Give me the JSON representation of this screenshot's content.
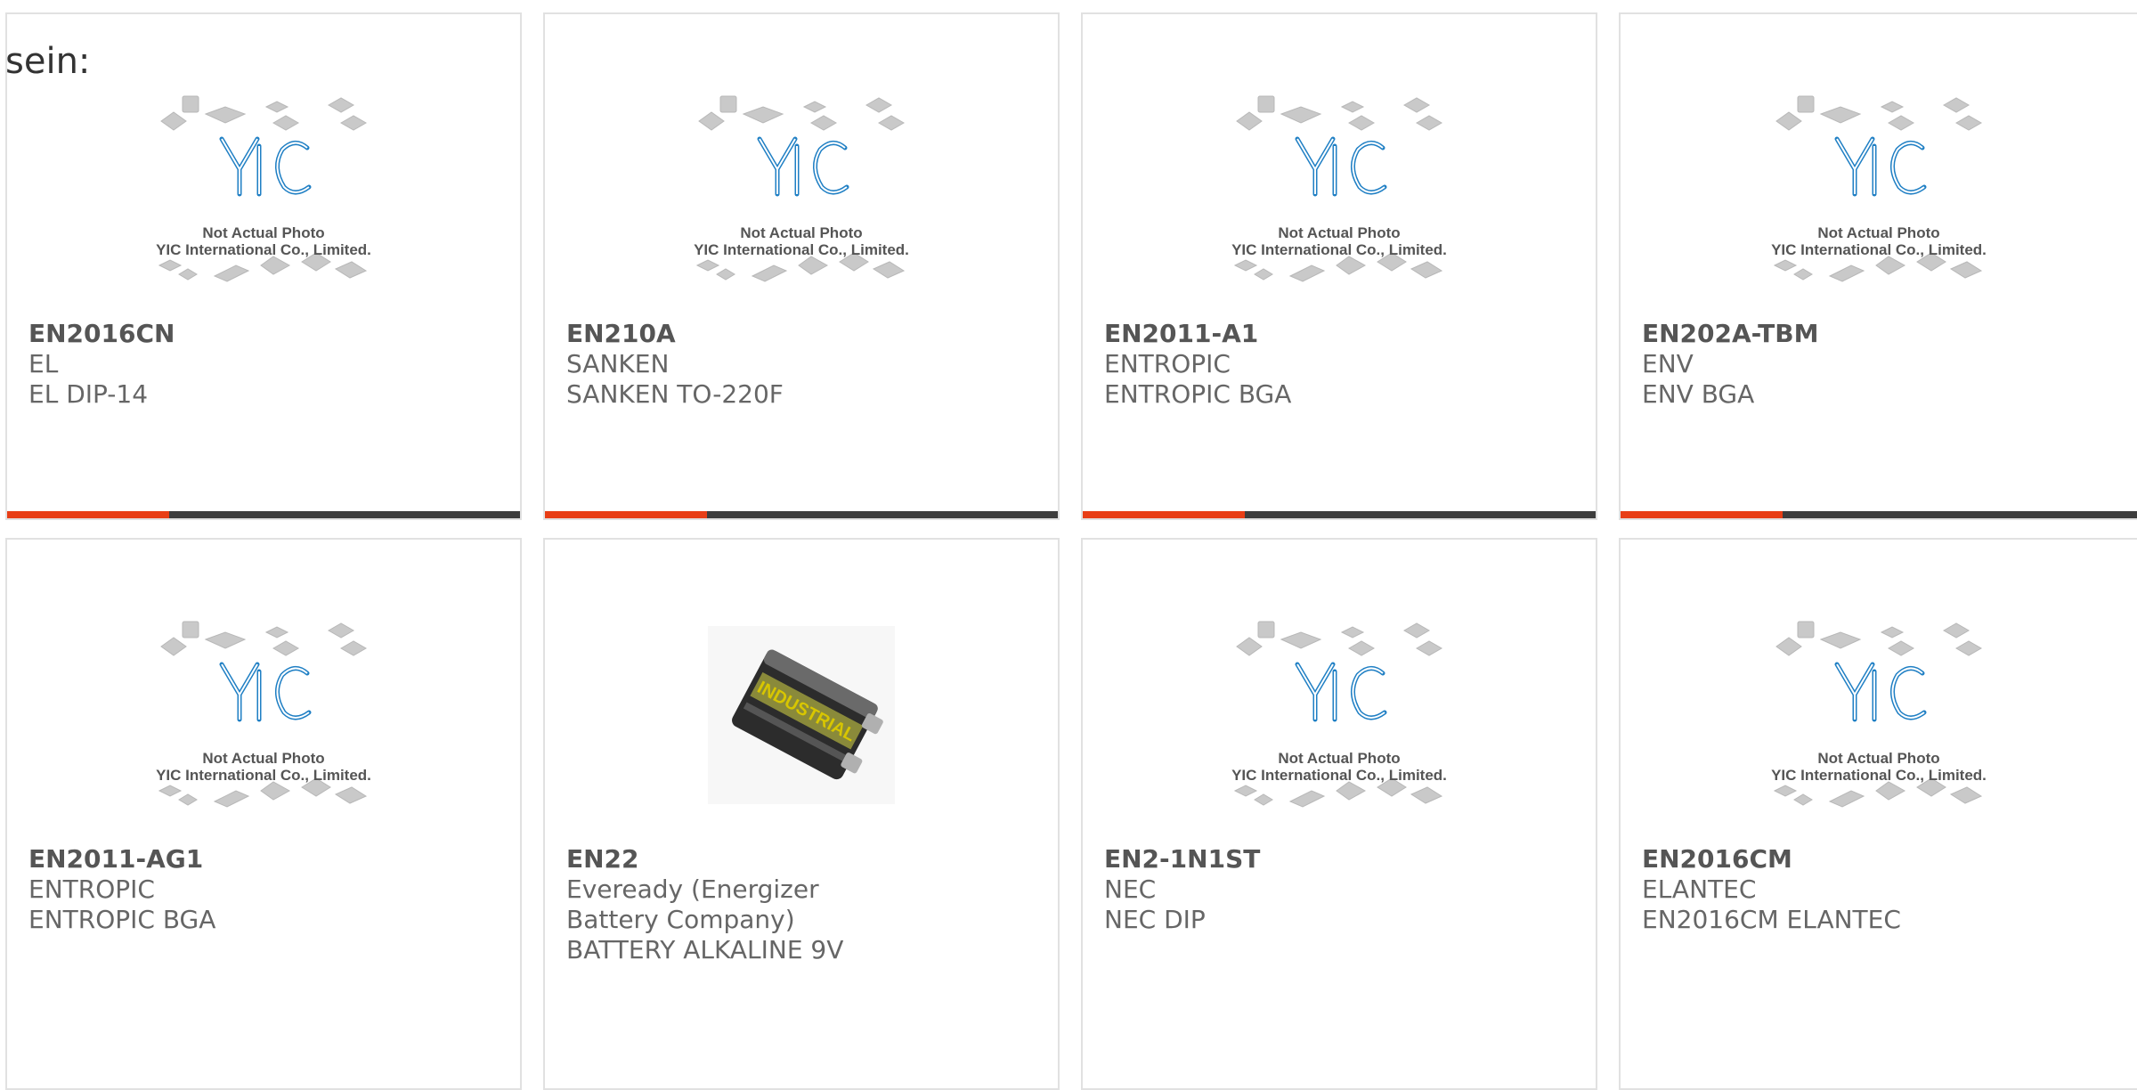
{
  "intro_text": "sein:",
  "placeholder": {
    "line1": "Not Actual Photo",
    "line2": "YIC International Co., Limited.",
    "logo_text": "YIC"
  },
  "colors": {
    "accent": "#e83e16",
    "bar": "#3d3d3d",
    "logo": "#1f7fc4",
    "chip": "#c9c9c9",
    "border": "#e1e1e1"
  },
  "cards": [
    {
      "part": "EN2016CN",
      "brand": "EL",
      "desc": "EL DIP-14",
      "image": "placeholder-chip-logo-icon"
    },
    {
      "part": "EN210A",
      "brand": "SANKEN",
      "desc": "SANKEN TO-220F",
      "image": "placeholder-chip-logo-icon"
    },
    {
      "part": "EN2011-A1",
      "brand": "ENTROPIC",
      "desc": "ENTROPIC BGA",
      "image": "placeholder-chip-logo-icon"
    },
    {
      "part": "EN202A-TBM",
      "brand": "ENV",
      "desc": "ENV BGA",
      "image": "placeholder-chip-logo-icon"
    },
    {
      "part": "EN2011-AG1",
      "brand": "ENTROPIC",
      "desc": "ENTROPIC BGA",
      "image": "placeholder-chip-logo-icon"
    },
    {
      "part": "EN22",
      "brand": "Eveready (Energizer Battery Company)",
      "desc": "BATTERY ALKALINE 9V",
      "image": "battery-photo-icon"
    },
    {
      "part": "EN2-1N1ST",
      "brand": "NEC",
      "desc": "NEC DIP",
      "image": "placeholder-chip-logo-icon"
    },
    {
      "part": "EN2016CM",
      "brand": "ELANTEC",
      "desc": "EN2016CM ELANTEC",
      "image": "placeholder-chip-logo-icon"
    }
  ]
}
